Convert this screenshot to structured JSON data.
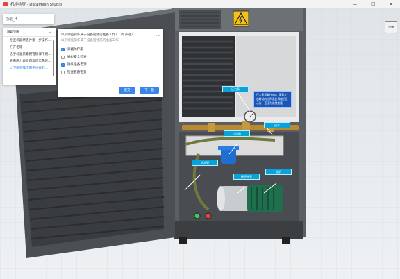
{
  "window": {
    "title": "机柜检查 · DataMesh Studio",
    "minimize_glyph": "—",
    "maximize_glyph": "☐",
    "close_glyph": "✕"
  },
  "exit_icon": "exit-icon",
  "sim_input": {
    "value": "拆装_4"
  },
  "task_panel": {
    "header": "跟踪列表",
    "items": [
      "检查机器状态并第一步操作...",
      "打开柜箱",
      "选手标准装箱把管操作下棚...",
      "查看压力表状态及时实先装...",
      "以下哪些操作属于设备的..."
    ],
    "active_index": 4
  },
  "question": {
    "title": "以下哪些操作属于设备检修前准备工作？（可多选）",
    "subtitle": "以下哪些操作属于设备检修前的准备工作",
    "options": [
      {
        "label": "穿戴防护服",
        "checked": true
      },
      {
        "label": "通过安全检查",
        "checked": false
      },
      {
        "label": "确认设备电源",
        "checked": true
      },
      {
        "label": "检查管路密封",
        "checked": false
      }
    ],
    "submit_label": "提交",
    "next_label": "下一题"
  },
  "tags": {
    "pressure_gauge": "压力表",
    "pressure_tip": "压力显示要在5%，需要左右转动向比例通比调度后显示为，直接为准检查值",
    "outlet": "出水",
    "filter": "过滤器",
    "inlet": "进水管",
    "pump": "循环水泵",
    "motor": "电机"
  },
  "colors": {
    "accent": "#3a86e8",
    "label_bg": "#0aa3d9",
    "tooltip_bg": "#1b55b8",
    "status_red": "#e0463c",
    "status_green": "#46c464"
  }
}
